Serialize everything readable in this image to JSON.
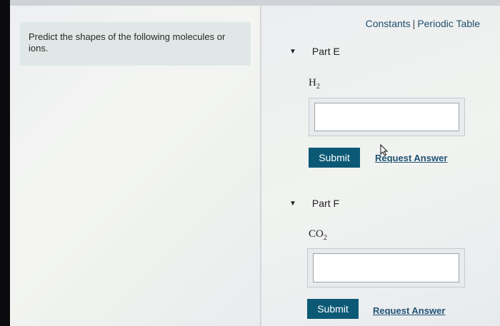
{
  "header": {
    "links": [
      "Constants",
      "Periodic Table"
    ],
    "separator": "|"
  },
  "problem": {
    "prompt": "Predict the shapes of the following molecules or ions."
  },
  "parts": [
    {
      "title": "Part E",
      "formula_base": "H",
      "formula_sub": "2",
      "input_value": "",
      "submit_label": "Submit",
      "request_label": "Request Answer"
    },
    {
      "title": "Part F",
      "formula_base": "CO",
      "formula_sub": "2",
      "input_value": "",
      "submit_label": "Submit",
      "request_label": "Request Answer"
    }
  ],
  "colors": {
    "submit_bg": "#0b5975",
    "link": "#1f4e6b",
    "prompt_bg": "#dfe8e6"
  }
}
